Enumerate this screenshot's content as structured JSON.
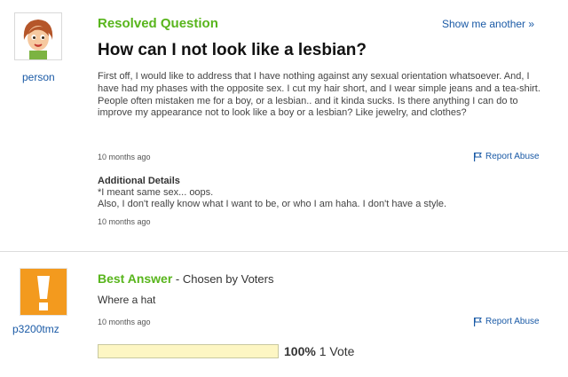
{
  "question": {
    "status": "Resolved Question",
    "show_another": "Show me another »",
    "title": "How can I not look like a lesbian?",
    "asker": "person",
    "body": "First off, I would like to address that I have nothing against any sexual orientation whatsoever. And, I have had my phases with the opposite sex. I cut my hair short, and I wear simple jeans and a tea-shirt. People often mistaken me for a boy, or a lesbian.. and it kinda sucks. Is there anything I can do to improve my appearance not to look like a boy or a lesbian? Like jewelry, and clothes?",
    "time": "10 months ago",
    "report": "Report Abuse",
    "additional_heading": "Additional Details",
    "additional_line1": "*I meant same sex... oops.",
    "additional_line2": "Also, I don't really know what I want to be, or who I am haha. I don't have a style.",
    "additional_time": "10 months ago"
  },
  "answer": {
    "label": "Best Answer",
    "chosen_by": " - Chosen by Voters",
    "answerer": "p3200tmz",
    "body": "Where a hat",
    "time": "10 months ago",
    "report": "Report Abuse",
    "vote_percent": "100%",
    "vote_count": "1 Vote",
    "vote_fraction": 1.0
  },
  "colors": {
    "accent_green": "#58b51c",
    "link_blue": "#1a5aa6",
    "answer_avatar": "#f39a1e"
  },
  "icons": {
    "question_avatar": "cartoon-girl-avatar-icon",
    "answer_avatar": "exclamation-avatar-icon",
    "report": "flag-icon"
  }
}
